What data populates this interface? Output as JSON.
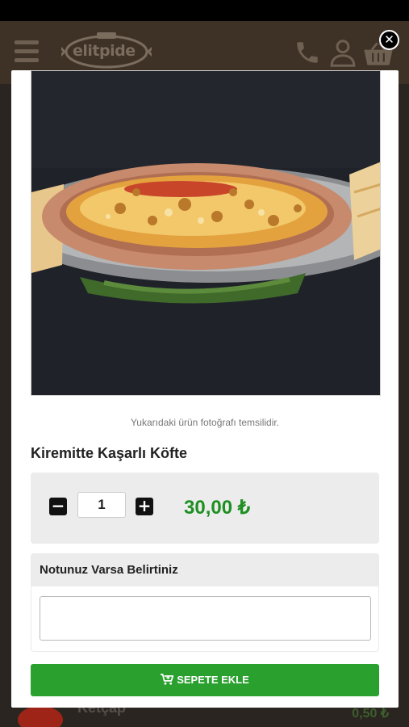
{
  "header": {
    "logo_text": "elitpide",
    "menu_icon": "hamburger-icon",
    "phone_icon": "phone-icon",
    "user_icon": "user-icon",
    "cart_icon": "shopping-basket-icon"
  },
  "background_row": {
    "name": "Ketçap",
    "price": "0,50 ₺"
  },
  "modal": {
    "close_icon": "close-icon",
    "photo_caption": "Yukarıdaki ürün fotoğrafı temsilidir.",
    "product_name": "Kiremitte Kaşarlı Köfte",
    "quantity": "1",
    "decrease_label": "−",
    "increase_label": "+",
    "price": "30,00 ₺",
    "note_title": "Notunuz Varsa Belirtiniz",
    "note_value": "",
    "add_button_label": "SEPETE EKLE",
    "add_button_icon": "cart-plus-icon"
  },
  "colors": {
    "header_bg": "#3e3126",
    "price_green": "#1e8f22",
    "button_green": "#2aa12f"
  }
}
